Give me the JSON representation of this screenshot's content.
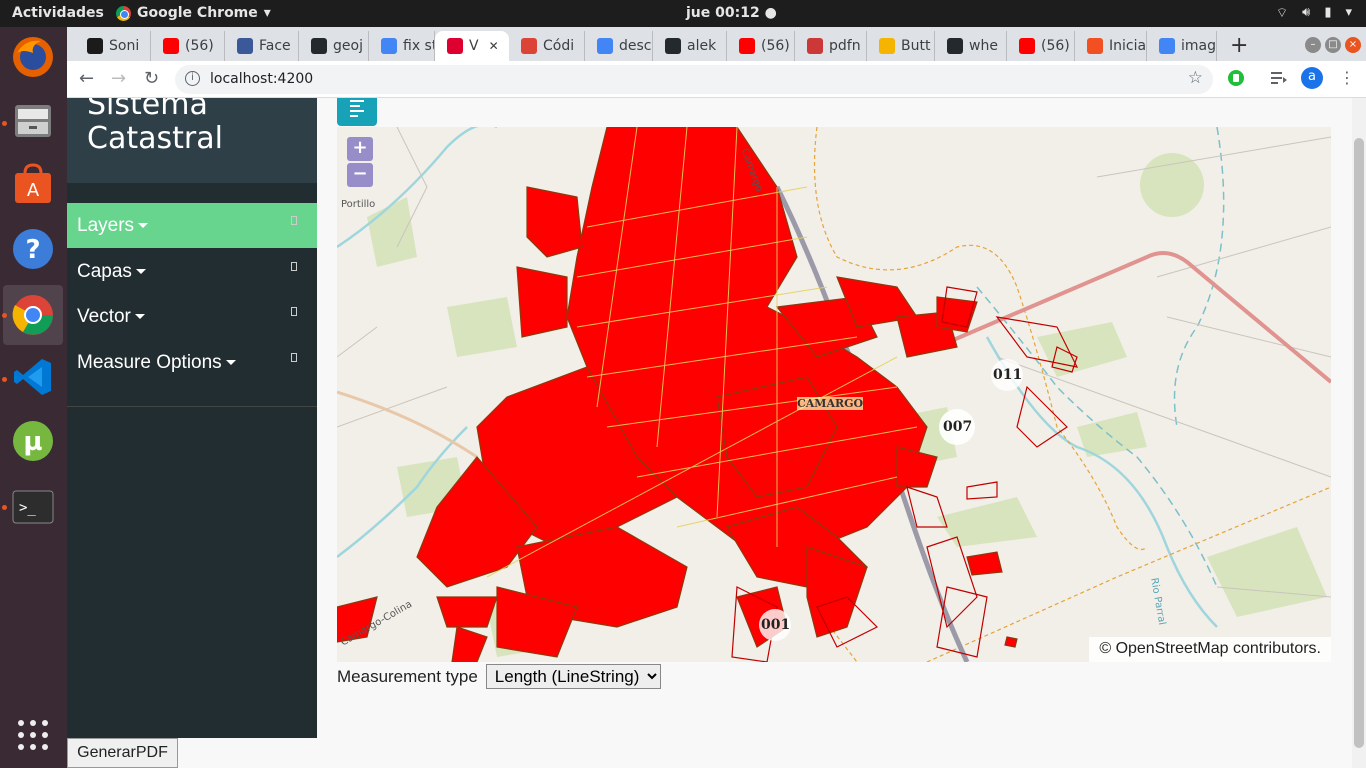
{
  "topbar": {
    "activities": "Actividades",
    "app_name": "Google Chrome",
    "clock": "jue 00:12"
  },
  "tabs": [
    {
      "label": "Soni",
      "icon": "c-logo-icon",
      "color": "#1b1b1b"
    },
    {
      "label": "(56)",
      "icon": "youtube-icon",
      "color": "#ff0000"
    },
    {
      "label": "Face",
      "icon": "facebook-icon",
      "color": "#3b5998"
    },
    {
      "label": "geoj",
      "icon": "github-icon",
      "color": "#24292e"
    },
    {
      "label": "fix st",
      "icon": "google-icon",
      "color": "#4285f4"
    },
    {
      "label": "V",
      "icon": "angular-icon",
      "color": "#dd0031"
    },
    {
      "label": "Códi",
      "icon": "chrome-icon",
      "color": "#db4437"
    },
    {
      "label": "desc",
      "icon": "google-icon",
      "color": "#4285f4"
    },
    {
      "label": "alek",
      "icon": "github-icon",
      "color": "#24292e"
    },
    {
      "label": "(56)",
      "icon": "youtube-icon",
      "color": "#ff0000"
    },
    {
      "label": "pdfn",
      "icon": "npm-icon",
      "color": "#cb3837"
    },
    {
      "label": "Butt",
      "icon": "shield-icon",
      "color": "#f4b400"
    },
    {
      "label": "whe",
      "icon": "github-icon",
      "color": "#24292e"
    },
    {
      "label": "(56)",
      "icon": "youtube-icon",
      "color": "#ff0000"
    },
    {
      "label": "Inicia",
      "icon": "microsoft-icon",
      "color": "#f25022"
    },
    {
      "label": "imag",
      "icon": "google-icon",
      "color": "#4285f4"
    }
  ],
  "address": {
    "url": "localhost:4200"
  },
  "profile_initial": "a",
  "sidebar": {
    "brand_line1": "Sistema",
    "brand_line2": "Catastral",
    "items": [
      {
        "label": "Layers"
      },
      {
        "label": "Capas"
      },
      {
        "label": "Vector"
      },
      {
        "label": "Measure Options"
      }
    ]
  },
  "map": {
    "labels": {
      "place": "CAMARGO",
      "road_top": "Camargo",
      "road_left": "Camargo-Colina",
      "portillo": "Portillo",
      "river": "Rio Parral",
      "badge_007": "007",
      "badge_011": "011",
      "badge_001": "001"
    },
    "attribution": "© OpenStreetMap contributors.",
    "zoom_in": "+",
    "zoom_out": "−"
  },
  "measure": {
    "label": "Measurement type",
    "selected": "Length (LineString)"
  },
  "pdf_button": "GenerarPDF"
}
